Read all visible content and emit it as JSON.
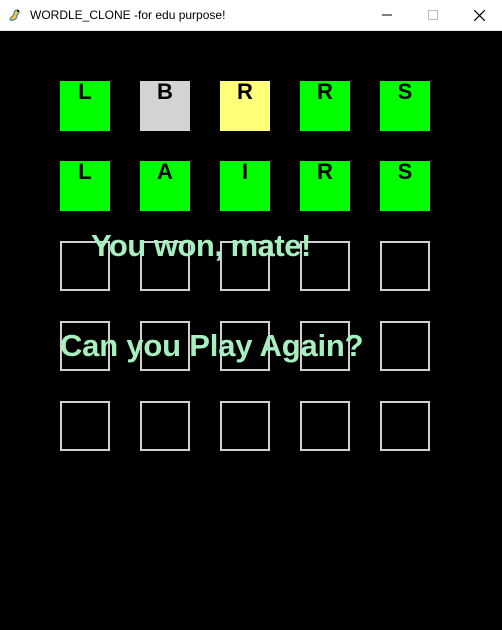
{
  "window": {
    "title": "WORDLE_CLONE -for edu purpose!",
    "icon": "pygame-snake-icon"
  },
  "colors": {
    "correct": "#00ff00",
    "absent": "#d3d3d3",
    "present": "#ffff7a",
    "message": "#a6f0bf",
    "background": "#000000",
    "empty_border": "#d0d0d0"
  },
  "board": {
    "rows": [
      [
        {
          "letter": "L",
          "state": "correct"
        },
        {
          "letter": "B",
          "state": "absent"
        },
        {
          "letter": "R",
          "state": "present"
        },
        {
          "letter": "R",
          "state": "correct"
        },
        {
          "letter": "S",
          "state": "correct"
        }
      ],
      [
        {
          "letter": "L",
          "state": "correct"
        },
        {
          "letter": "A",
          "state": "correct"
        },
        {
          "letter": "I",
          "state": "correct"
        },
        {
          "letter": "R",
          "state": "correct"
        },
        {
          "letter": "S",
          "state": "correct"
        }
      ],
      [
        {
          "letter": "",
          "state": "empty"
        },
        {
          "letter": "",
          "state": "empty"
        },
        {
          "letter": "",
          "state": "empty"
        },
        {
          "letter": "",
          "state": "empty"
        },
        {
          "letter": "",
          "state": "empty"
        }
      ],
      [
        {
          "letter": "",
          "state": "empty"
        },
        {
          "letter": "",
          "state": "empty"
        },
        {
          "letter": "",
          "state": "empty"
        },
        {
          "letter": "",
          "state": "empty"
        },
        {
          "letter": "",
          "state": "empty"
        }
      ],
      [
        {
          "letter": "",
          "state": "empty"
        },
        {
          "letter": "",
          "state": "empty"
        },
        {
          "letter": "",
          "state": "empty"
        },
        {
          "letter": "",
          "state": "empty"
        },
        {
          "letter": "",
          "state": "empty"
        }
      ]
    ]
  },
  "messages": {
    "won": "You won, mate!",
    "play_again": "Can you Play Again?"
  }
}
